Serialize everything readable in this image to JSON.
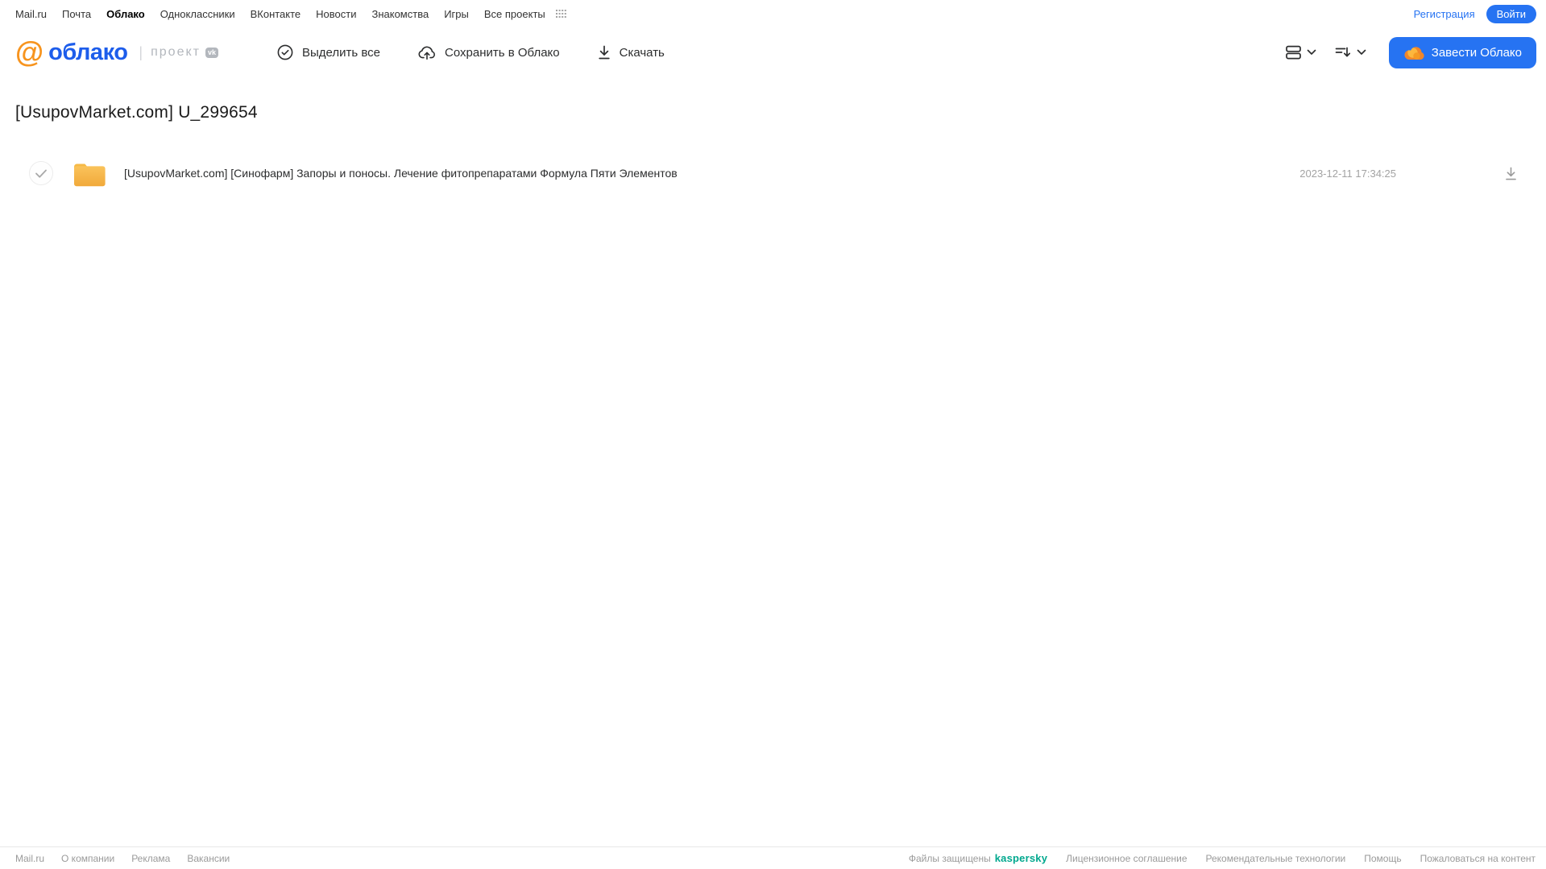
{
  "portal_nav": {
    "links": [
      {
        "label": "Mail.ru",
        "active": false
      },
      {
        "label": "Почта",
        "active": false
      },
      {
        "label": "Облако",
        "active": true
      },
      {
        "label": "Одноклассники",
        "active": false
      },
      {
        "label": "ВКонтакте",
        "active": false
      },
      {
        "label": "Новости",
        "active": false
      },
      {
        "label": "Знакомства",
        "active": false
      },
      {
        "label": "Игры",
        "active": false
      },
      {
        "label": "Все проекты",
        "active": false
      }
    ],
    "registration_label": "Регистрация",
    "login_label": "Войти"
  },
  "header": {
    "at_icon": "@",
    "logo_text": "облако",
    "logo_divider": "|",
    "project_label": "проект",
    "vk_badge": "vk",
    "toolbar": {
      "select_all_label": "Выделить все",
      "save_to_cloud_label": "Сохранить в Облако",
      "download_label": "Скачать"
    },
    "get_cloud_button_label": "Завести Облако"
  },
  "main": {
    "page_title": "[UsupovMarket.com] U_299654",
    "files": [
      {
        "type": "folder",
        "name": "[UsupovMarket.com] [Синофарм] Запоры и поносы. Лечение фитопрепаратами Формула Пяти Элементов",
        "modified": "2023-12-11 17:34:25"
      }
    ]
  },
  "footer": {
    "left_links": [
      "Mail.ru",
      "О компании",
      "Реклама",
      "Вакансии"
    ],
    "protected_label": "Файлы защищены",
    "kaspersky_label": "kaspersky",
    "right_links": [
      "Лицензионное соглашение",
      "Рекомендательные технологии",
      "Помощь",
      "Пожаловаться на контент"
    ]
  },
  "colors": {
    "accent_blue": "#2673f2",
    "logo_blue": "#1d5deb",
    "logo_orange": "#f7941e",
    "folder_yellow": "#f7b942",
    "kaspersky_teal": "#00a88e",
    "footer_gray": "#9a9a9a"
  }
}
